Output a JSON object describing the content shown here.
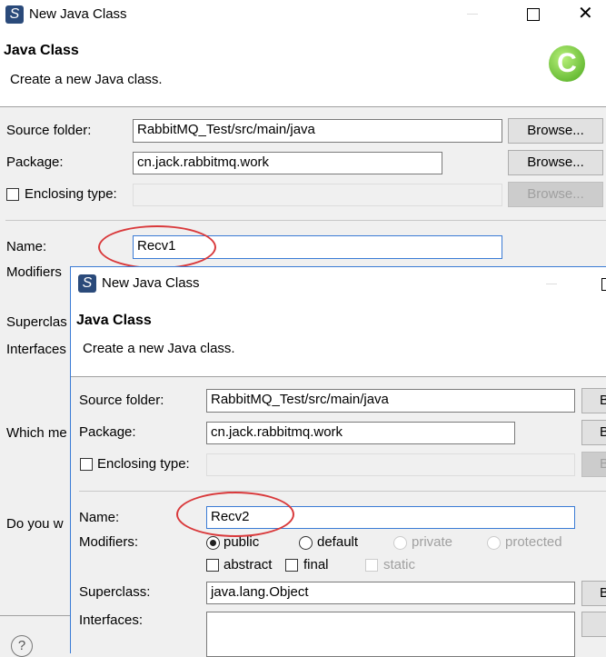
{
  "back": {
    "title": "New Java Class",
    "header_title": "Java Class",
    "header_desc": "Create a new Java class.",
    "source_folder_label": "Source folder:",
    "source_folder_value": "RabbitMQ_Test/src/main/java",
    "package_label": "Package:",
    "package_value": "cn.jack.rabbitmq.work",
    "enclosing_label": "Enclosing type:",
    "browse": "Browse...",
    "name_label": "Name:",
    "name_value": "Recv1",
    "modifiers_label": "Modifiers",
    "superclass_label": "Superclas",
    "interfaces_label": "Interfaces",
    "which_label": "Which me",
    "doyou_label": "Do you w"
  },
  "front": {
    "title": "New Java Class",
    "header_title": "Java Class",
    "header_desc": "Create a new Java class.",
    "source_folder_label": "Source folder:",
    "source_folder_value": "RabbitMQ_Test/src/main/java",
    "package_label": "Package:",
    "package_value": "cn.jack.rabbitmq.work",
    "enclosing_label": "Enclosing type:",
    "browse_partial": "B",
    "name_label": "Name:",
    "name_value": "Recv2",
    "modifiers_label": "Modifiers:",
    "modifiers": [
      {
        "label": "public",
        "selected": true
      },
      {
        "label": "default"
      },
      {
        "label": "private",
        "disabled": true
      },
      {
        "label": "protected",
        "disabled": true
      }
    ],
    "abstract": "abstract",
    "final": "final",
    "static": "static",
    "superclass_label": "Superclass:",
    "superclass_value": "java.lang.Object",
    "interfaces_label": "Interfaces:"
  },
  "colors": {
    "annotation": "#d9393b",
    "accent": "#3a7bd5"
  }
}
